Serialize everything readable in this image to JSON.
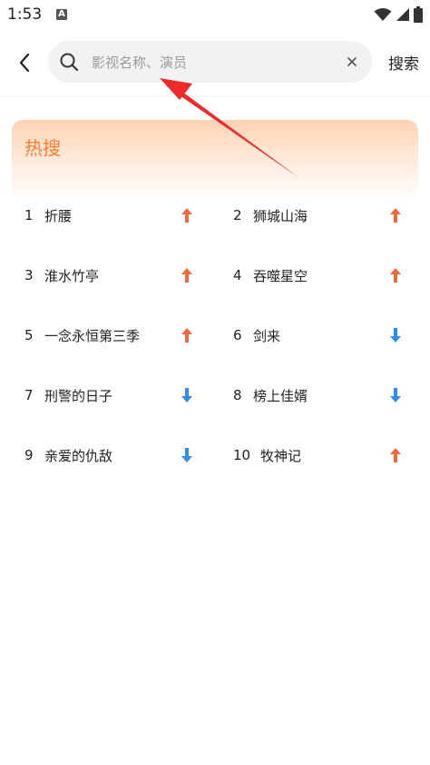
{
  "status_bar": {
    "time": "1:53",
    "notification_icon": "A",
    "icons": [
      "wifi-icon",
      "signal-icon",
      "battery-icon"
    ]
  },
  "header": {
    "back_icon": "chevron-left-icon",
    "search": {
      "placeholder": "影视名称、演员",
      "value": "",
      "search_icon": "magnifier-icon",
      "clear_icon": "close-icon"
    },
    "search_button_label": "搜索"
  },
  "hot_search": {
    "title": "热搜",
    "items": [
      {
        "rank": "1",
        "title": "折腰",
        "trend": "up"
      },
      {
        "rank": "2",
        "title": "狮城山海",
        "trend": "up"
      },
      {
        "rank": "3",
        "title": "淮水竹亭",
        "trend": "up"
      },
      {
        "rank": "4",
        "title": "吞噬星空",
        "trend": "up"
      },
      {
        "rank": "5",
        "title": "一念永恒第三季",
        "trend": "up"
      },
      {
        "rank": "6",
        "title": "剑来",
        "trend": "down"
      },
      {
        "rank": "7",
        "title": "刑警的日子",
        "trend": "down"
      },
      {
        "rank": "8",
        "title": "榜上佳婿",
        "trend": "down"
      },
      {
        "rank": "9",
        "title": "亲爱的仇敌",
        "trend": "down"
      },
      {
        "rank": "10",
        "title": "牧神记",
        "trend": "up"
      }
    ]
  },
  "colors": {
    "accent": "#ff7a2e",
    "trend_up": "#ef6a3a",
    "trend_down": "#2f8fe6",
    "annotation_arrow": "#ee2b2b"
  }
}
